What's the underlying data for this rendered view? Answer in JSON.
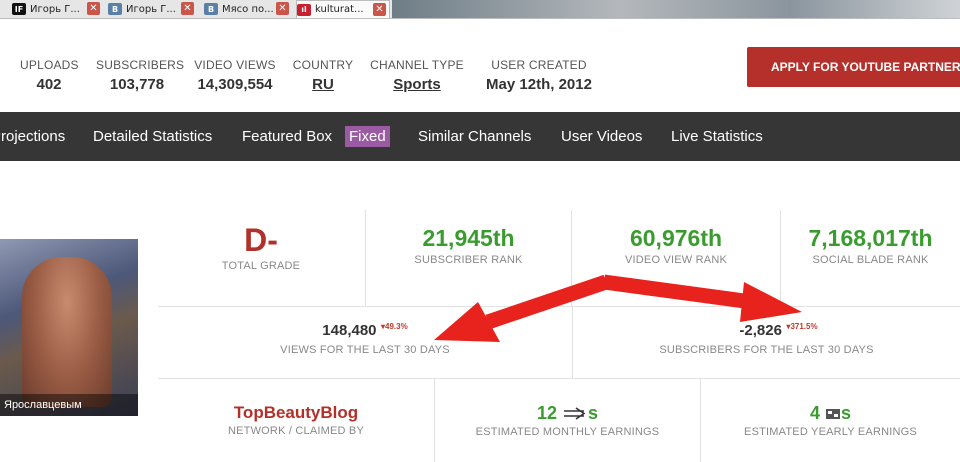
{
  "tabs": [
    {
      "label": "Игорь Г...",
      "icon": "IF"
    },
    {
      "label": "Игорь Г...",
      "icon": "B"
    },
    {
      "label": "Мясо по...",
      "icon": "B"
    },
    {
      "label": "kulturat...",
      "icon": "ıl"
    }
  ],
  "stats": {
    "uploads": {
      "label": "UPLOADS",
      "value": "402"
    },
    "subscribers": {
      "label": "SUBSCRIBERS",
      "value": "103,778"
    },
    "video_views": {
      "label": "VIDEO VIEWS",
      "value": "14,309,554"
    },
    "country": {
      "label": "COUNTRY",
      "value": "RU"
    },
    "channel_type": {
      "label": "CHANNEL TYPE",
      "value": "Sports"
    },
    "user_created": {
      "label": "USER CREATED",
      "value": "May 12th, 2012"
    }
  },
  "apply_button": "APPLY FOR YOUTUBE PARTNERSHIP",
  "nav": [
    "Projections",
    "Detailed Statistics",
    "Featured Box",
    "Fixed",
    "Similar Channels",
    "User Videos",
    "Live Statistics"
  ],
  "avatar_caption": "Ярославцевым",
  "grade": {
    "value": "D-",
    "label": "TOTAL GRADE"
  },
  "ranks": [
    {
      "value": "21,945th",
      "label": "SUBSCRIBER RANK"
    },
    {
      "value": "60,976th",
      "label": "VIDEO VIEW RANK"
    },
    {
      "value": "7,168,017th",
      "label": "SOCIAL BLADE RANK"
    }
  ],
  "views_30": {
    "value": "148,480",
    "change": "49.3%",
    "label": "VIEWS FOR THE LAST 30 DAYS"
  },
  "subs_30": {
    "value": "-2,826",
    "change": "371.5%",
    "label": "SUBSCRIBERS FOR THE LAST 30 DAYS"
  },
  "network": {
    "value": "TopBeautyBlog",
    "label": "NETWORK / CLAIMED BY"
  },
  "monthly": {
    "value": "12",
    "label": "ESTIMATED MONTHLY EARNINGS"
  },
  "yearly": {
    "value": "4",
    "label": "ESTIMATED YEARLY EARNINGS"
  },
  "colors": {
    "accent_red": "#b3302a",
    "rank_green": "#3a9c2e",
    "nav_bg": "#363636",
    "fixed_highlight": "#9a5ba3",
    "arrow": "#e8221c"
  }
}
